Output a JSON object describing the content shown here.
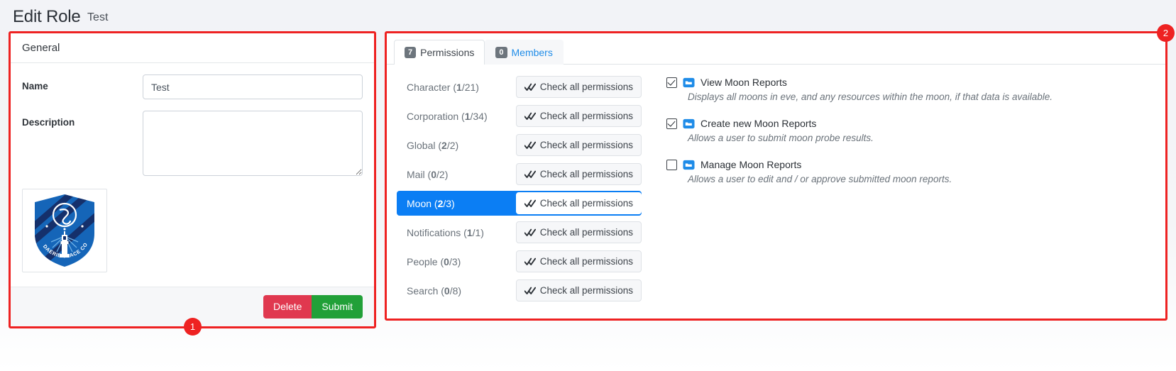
{
  "header": {
    "title": "Edit Role",
    "subtitle": "Test"
  },
  "annotations": {
    "badge_left": "1",
    "badge_right": "2",
    "outline_color": "#ee2222"
  },
  "left_panel": {
    "card_title": "General",
    "fields": [
      {
        "label": "Name",
        "value": "Test",
        "placeholder": ""
      },
      {
        "label": "Description",
        "value": "",
        "placeholder": ""
      }
    ],
    "logo": {
      "alt": "Daerie Space Command crest",
      "line1": "DAERIE SPACE COMMAND"
    },
    "buttons": {
      "delete": "Delete",
      "submit": "Submit"
    },
    "colors": {
      "delete": "#e0384f",
      "submit": "#21a038"
    }
  },
  "right_panel": {
    "tabs": [
      {
        "count": "7",
        "label": "Permissions",
        "active": true
      },
      {
        "count": "0",
        "label": "Members",
        "active": false
      }
    ],
    "check_all_label": "Check all permissions",
    "categories": [
      {
        "name": "Character",
        "granted": "1",
        "total": "21",
        "selected": false
      },
      {
        "name": "Corporation",
        "granted": "1",
        "total": "34",
        "selected": false
      },
      {
        "name": "Global",
        "granted": "2",
        "total": "2",
        "selected": false
      },
      {
        "name": "Mail",
        "granted": "0",
        "total": "2",
        "selected": false
      },
      {
        "name": "Moon",
        "granted": "2",
        "total": "3",
        "selected": true
      },
      {
        "name": "Notifications",
        "granted": "1",
        "total": "1",
        "selected": false
      },
      {
        "name": "People",
        "granted": "0",
        "total": "3",
        "selected": false
      },
      {
        "name": "Search",
        "granted": "0",
        "total": "8",
        "selected": false
      }
    ],
    "permissions": [
      {
        "title": "View Moon Reports",
        "description": "Displays all moons in eve, and any resources within the moon, if that data is available.",
        "checked": true
      },
      {
        "title": "Create new Moon Reports",
        "description": "Allows a user to submit moon probe results.",
        "checked": true
      },
      {
        "title": "Manage Moon Reports",
        "description": "Allows a user to edit and / or approve submitted moon reports.",
        "checked": false
      }
    ],
    "colors": {
      "selected_row": "#0b7ef4",
      "tab_link": "#1f8ce8",
      "folder_icon": "#1f8ce8"
    }
  }
}
